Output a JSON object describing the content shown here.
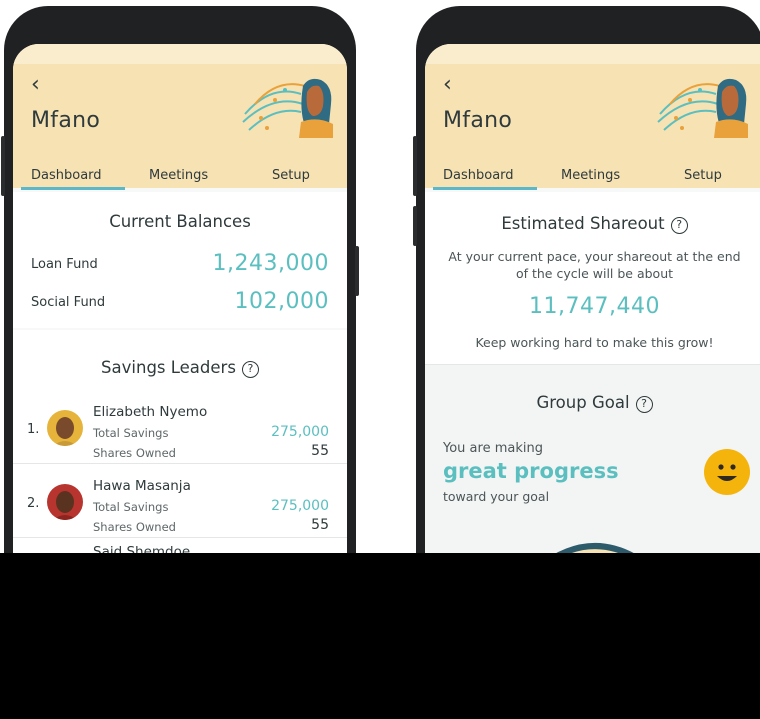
{
  "left_phone": {
    "back_icon": "‹",
    "title": "Mfano",
    "tabs": [
      {
        "label": "Dashboard",
        "active": true
      },
      {
        "label": "Meetings",
        "active": false
      },
      {
        "label": "Setup",
        "active": false
      }
    ],
    "balances": {
      "heading": "Current Balances",
      "loan_fund_label": "Loan Fund",
      "loan_fund_value": "1,243,000",
      "social_fund_label": "Social Fund",
      "social_fund_value": "102,000"
    },
    "leaders": {
      "heading": "Savings Leaders",
      "help_icon": "?",
      "items": [
        {
          "rank": "1.",
          "name": "Elizabeth Nyemo",
          "savings_label": "Total Savings",
          "savings_value": "275,000",
          "shares_label": "Shares Owned",
          "shares_value": "55"
        },
        {
          "rank": "2.",
          "name": "Hawa Masanja",
          "savings_label": "Total Savings",
          "savings_value": "275,000",
          "shares_label": "Shares Owned",
          "shares_value": "55"
        },
        {
          "rank": "",
          "name": "Said Shemdoe"
        }
      ]
    }
  },
  "right_phone": {
    "back_icon": "‹",
    "title": "Mfano",
    "tabs": [
      {
        "label": "Dashboard",
        "active": true
      },
      {
        "label": "Meetings",
        "active": false
      },
      {
        "label": "Setup",
        "active": false
      }
    ],
    "shareout": {
      "heading": "Estimated Shareout",
      "help_icon": "?",
      "description": "At your current pace, your shareout at the end of the cycle will be about",
      "value": "11,747,440",
      "encouragement": "Keep working hard to make this grow!"
    },
    "goal": {
      "heading": "Group Goal",
      "help_icon": "?",
      "intro": "You are making",
      "highlight": "great progress",
      "outro": "toward your goal"
    }
  },
  "colors": {
    "header_bg": "#f6e2b3",
    "accent_teal": "#5bbfc0",
    "tab_underline": "#5cb8c8",
    "smiley_yellow": "#f5b40b",
    "text_dark": "#2f3a3c",
    "phone_frame": "#1f2123"
  },
  "icons": [
    "back-chevron-icon",
    "help-circle-icon",
    "smiley-icon",
    "avatar-photo",
    "header-illustration"
  ]
}
